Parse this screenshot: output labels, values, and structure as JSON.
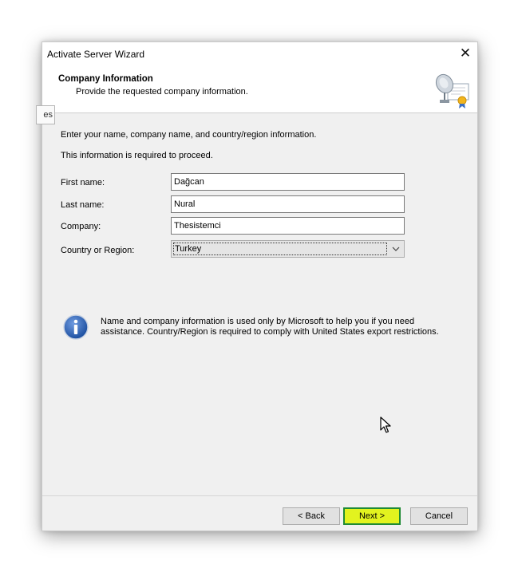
{
  "window": {
    "title": "Activate Server Wizard",
    "close_glyph": "✕"
  },
  "header": {
    "title": "Company Information",
    "subtitle": "Provide the requested company information.",
    "icon": "certificate-satellite-icon"
  },
  "side_tab": {
    "label": "es"
  },
  "body": {
    "instruction": "Enter your name, company name, and country/region information.",
    "required_note": "This information is required to proceed."
  },
  "form": {
    "first_name": {
      "label": "First name:",
      "value": "Dağcan"
    },
    "last_name": {
      "label": "Last name:",
      "value": "Nural"
    },
    "company": {
      "label": "Company:",
      "value": "Thesistemci"
    },
    "country": {
      "label": "Country or Region:",
      "value": "Turkey"
    }
  },
  "info": {
    "icon": "info-icon",
    "text": "Name and company information is used only by Microsoft to help you if you need assistance. Country/Region is required to comply with United States export restrictions."
  },
  "buttons": {
    "back": "< Back",
    "next": "Next >",
    "cancel": "Cancel"
  },
  "colors": {
    "next_highlight": "#e2f31f",
    "next_border": "#1f8a35",
    "info_blue": "#1c4fa0"
  }
}
